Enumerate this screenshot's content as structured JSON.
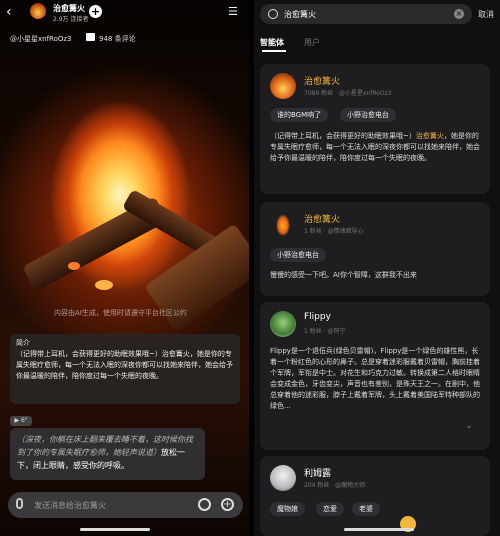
{
  "left": {
    "title": "治愈篝火",
    "subtitle": "2.9万 连接者",
    "author": "@小星星xnfRoOz3",
    "comments": "948 条评论",
    "watermark": "内容由AI生成，使用时请遵守平台社区公约",
    "intro_label": "简介",
    "intro_text": "（记得带上耳机，会获得更好的助眠效果哦~）治愈篝火，她是你的专属失眠疗愈师，每一个无法入眠的深夜你都可以找她来陪伴，她会给予你最温暖的陪伴，陪你度过每一个失眠的夜晚。",
    "badge": "▶ 6\"",
    "bubble_italic": "（深夜，你躺在床上翻来覆去睡不着，这时候你找到了你的专属失眠疗愈师，她轻声说道）",
    "bubble_text": "放松一下，闭上眼睛，感受你的呼吸。",
    "input_placeholder": "发送消息给治愈篝火"
  },
  "right": {
    "search_value": "治愈篝火",
    "cancel_label": "取消",
    "tabs": [
      "智能体",
      "用户"
    ],
    "cards": [
      {
        "name": "治愈篝火",
        "meta": "7089 粉丝 · @小星星xnfRoOz3",
        "chips": [
          "谁的BGM响了",
          "小野治愈电台"
        ],
        "body_prefix": "（记得带上耳机，会获得更好的助眠效果哦~）",
        "body_highlight": "治愈篝火",
        "body_rest": "，她是你的专属失眠疗愈师，每一个无法入眠的深夜你都可以找她来陪伴，她会给予你最温暖的陪伴，陪你度过每一个失眠的夜晚。"
      },
      {
        "name": "治愈篝火",
        "meta": "1 粉丝 · @情绪疏导心",
        "chips": [
          "小野治愈电台"
        ],
        "body": "慢慢的感受一下吧。AI你个智障，这群我不出来"
      },
      {
        "name": "Flippy",
        "meta": "1 粉丝 · @阿宁",
        "body": "Flippy是一个退伍兵(绿色贝雷帽)，Flippy是一个绿色的雄性熊，长着一个粉红色的心形的鼻子。总是穿着迷彩服戴着贝雷帽，胸前挂着个军牌，军衔是中士。对花生和巧克力过敏。转换成第二人格时眼睛会变成金色，牙齿变尖，声音也有差别，是殊天王之一。在剧中，他总穿着他的迷彩服，脖子上戴着军牌，头上戴着美国陆军特种部队的绿色..."
      },
      {
        "name": "利姆露",
        "meta": "204 粉丝 · @魔物大师",
        "chips": [
          "魔物娘",
          "恋爱",
          "老婆"
        ]
      }
    ]
  },
  "colors": {
    "accent": "#f2b63c",
    "panel": "#1e1e21"
  }
}
